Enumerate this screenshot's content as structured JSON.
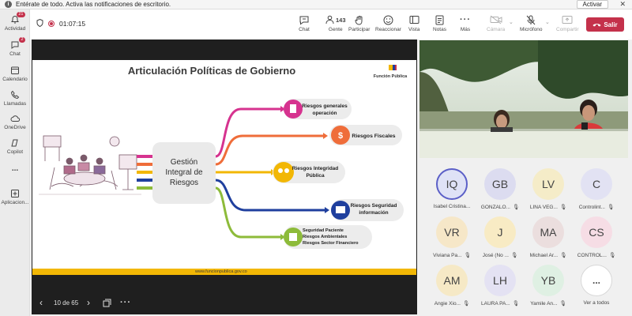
{
  "banner": {
    "text": "Entérate de todo. Activa las notificaciones de escritorio.",
    "button": "Activar"
  },
  "rail": [
    {
      "label": "Actividad",
      "icon": "bell-icon",
      "badge": "21"
    },
    {
      "label": "Chat",
      "icon": "chat-icon",
      "badge": "2"
    },
    {
      "label": "Calendario",
      "icon": "calendar-icon",
      "badge": ""
    },
    {
      "label": "Llamadas",
      "icon": "phone-icon",
      "badge": ""
    },
    {
      "label": "OneDrive",
      "icon": "cloud-icon",
      "badge": ""
    },
    {
      "label": "Copilot",
      "icon": "copilot-icon",
      "badge": ""
    },
    {
      "label": "...",
      "icon": "more-icon",
      "badge": ""
    },
    {
      "label": "Aplicacion...",
      "icon": "apps-icon",
      "badge": ""
    }
  ],
  "meeting": {
    "timer": "01:07:15"
  },
  "toolbar": [
    {
      "label": "Chat",
      "icon": "chat-icon"
    },
    {
      "label": "Gente",
      "icon": "people-icon",
      "count": "143"
    },
    {
      "label": "Participar",
      "icon": "hand-icon"
    },
    {
      "label": "Reaccionar",
      "icon": "smile-icon"
    },
    {
      "label": "Vista",
      "icon": "view-icon"
    },
    {
      "label": "Notas",
      "icon": "notes-icon"
    },
    {
      "label": "Más",
      "icon": "more-icon"
    }
  ],
  "devices": [
    {
      "label": "Cámara",
      "icon": "camera-off-icon"
    },
    {
      "label": "Micrófono",
      "icon": "mic-off-icon"
    },
    {
      "label": "Compartir",
      "icon": "share-icon"
    }
  ],
  "leave": "Salir",
  "slide": {
    "title": "Articulación Políticas de Gobierno",
    "brand": "Función Pública",
    "center": [
      "Gestión",
      "Integral de",
      "Riesgos"
    ],
    "items": [
      [
        "Riesgos generales",
        "operación"
      ],
      [
        "Riesgos Fiscales"
      ],
      [
        "Riesgos Integridad",
        "Pública"
      ],
      [
        "Riesgos Seguridad",
        "información"
      ],
      [
        "Seguridad Paciente",
        "Riesgos Ambientales",
        "Riesgos Sector Financiero"
      ]
    ],
    "footer": "www.funcionpublica.gov.co",
    "colors": [
      "#d6338f",
      "#ef6d3a",
      "#f2b705",
      "#1f3f9e",
      "#8dbb3a"
    ]
  },
  "pager": {
    "text": "10 de 65"
  },
  "participants": [
    {
      "initials": "IQ",
      "name": "Isabel Cristina...",
      "bg": "#dfe2f6",
      "active": true
    },
    {
      "initials": "GB",
      "name": "GONZALO...",
      "bg": "#dcdcf0"
    },
    {
      "initials": "LV",
      "name": "LINA VEG...",
      "bg": "#f5ecc8"
    },
    {
      "initials": "C",
      "name": "Controlint...",
      "bg": "#e2e2f3"
    },
    {
      "initials": "VR",
      "name": "Viviana Pa...",
      "bg": "#f6e7c8"
    },
    {
      "initials": "J",
      "name": "José (No ...",
      "bg": "#f8ebc4"
    },
    {
      "initials": "MA",
      "name": "Michael Ar...",
      "bg": "#ebdede"
    },
    {
      "initials": "CS",
      "name": "CONTROL...",
      "bg": "#f6dde5"
    },
    {
      "initials": "AM",
      "name": "Angie Xio...",
      "bg": "#f6e9c6"
    },
    {
      "initials": "LH",
      "name": "LAURA PA...",
      "bg": "#e4e2f3"
    },
    {
      "initials": "YB",
      "name": "Yamile An...",
      "bg": "#dff0e3"
    },
    {
      "initials": "...",
      "name": "Ver a todos",
      "bg": "#ffffff"
    }
  ]
}
